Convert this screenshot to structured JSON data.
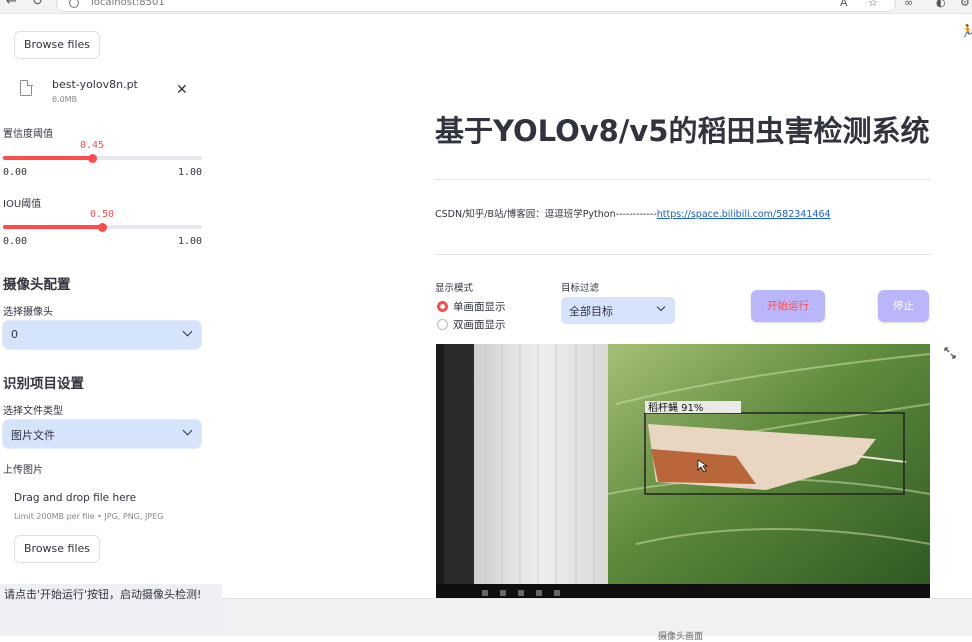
{
  "browser": {
    "url": "localhost:8501"
  },
  "sidebar": {
    "upload_model": {
      "button": "Browse files",
      "file_name": "best-yolov8n.pt",
      "file_size": "6.0MB"
    },
    "conf_slider": {
      "label": "置信度阈值",
      "value": 0.45,
      "value_text": "0.45",
      "min": "0.00",
      "max": "1.00"
    },
    "iou_slider": {
      "label": "IOU阈值",
      "value": 0.5,
      "value_text": "0.50",
      "min": "0.00",
      "max": "1.00"
    },
    "camera_section": {
      "title": "摄像头配置",
      "select_label": "选择摄像头",
      "selected": "0"
    },
    "recognition_section": {
      "title": "识别项目设置",
      "file_type_label": "选择文件类型",
      "file_type_selected": "图片文件",
      "upload_label": "上传图片"
    },
    "dropzone": {
      "title": "Drag and drop file here",
      "hint": "Limit 200MB per file • JPG, PNG, JPEG",
      "button": "Browse files"
    },
    "info": "请点击'开始运行'按钮，启动摄像头检测!"
  },
  "main": {
    "title": "基于YOLOv8/v5的稻田虫害检测系统",
    "links_prefix": "CSDN/知乎/B站/博客园：逗逗班学Python------------",
    "link": "https://space.bilibili.com/582341464",
    "display_mode": {
      "label": "显示模式",
      "options": [
        "单画面显示",
        "双画面显示"
      ],
      "selected_index": 0
    },
    "target_filter": {
      "label": "目标过滤",
      "selected": "全部目标"
    },
    "start_button": "开始运行",
    "stop_button": "停止",
    "detection": {
      "label": "稻杆蝇",
      "confidence": "91%"
    },
    "bottom_caption": "摄像头画面"
  },
  "colors": {
    "accent": "#ff4b4b",
    "select_bg": "#d5e3fb",
    "button_bg": "#b9b6fa",
    "link": "#1c5fd1"
  }
}
